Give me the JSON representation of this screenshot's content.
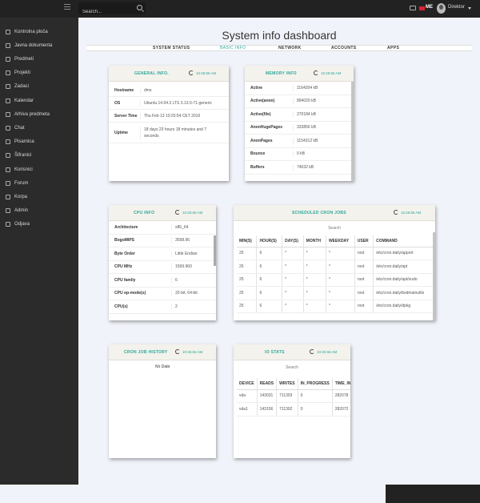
{
  "topbar": {
    "search_placeholder": "Search...",
    "lang": "ME",
    "user": "Direktor"
  },
  "sidebar": {
    "items": [
      {
        "label": "Kontrolna ploča",
        "icon": "dashboard-icon"
      },
      {
        "label": "Javna dokumenta",
        "icon": "folder-icon"
      },
      {
        "label": "Predmeti",
        "icon": "folder-icon"
      },
      {
        "label": "Projekti",
        "icon": "briefcase-icon"
      },
      {
        "label": "Zadaci",
        "icon": "tasks-icon"
      },
      {
        "label": "Kalendar",
        "icon": "calendar-icon"
      },
      {
        "label": "Arhiva predmeta",
        "icon": "archive-icon"
      },
      {
        "label": "Chat",
        "icon": "chat-icon"
      },
      {
        "label": "Pisarnica",
        "icon": "list-icon"
      },
      {
        "label": "Šifranici",
        "icon": "wrench-icon"
      },
      {
        "label": "Korisnici",
        "icon": "users-icon"
      },
      {
        "label": "Forum",
        "icon": "forum-icon"
      },
      {
        "label": "Korpa",
        "icon": "trash-icon"
      },
      {
        "label": "Admin",
        "icon": "admin-icon"
      },
      {
        "label": "Odjava",
        "icon": "logout-icon"
      }
    ]
  },
  "main": {
    "title": "System info dashboard",
    "tabs": [
      "SYSTEM STATUS",
      "BASIC INFO",
      "NETWORK",
      "ACCOUNTS",
      "APPS"
    ],
    "active_tab": "BASIC INFO"
  },
  "general": {
    "title": "GENERAL INFO.",
    "time": "10:25:56 AM",
    "rows": [
      {
        "k": "Hostname",
        "v": "dms"
      },
      {
        "k": "OS",
        "v": "Ubuntu 14.04.3 LTS 3.13.0-71-generic"
      },
      {
        "k": "Server Time",
        "v": "Thu Feb 13 10:25:54 CET 2016"
      },
      {
        "k": "Uptime",
        "v": "18 days 23 hours 18 minutes and 7 seconds"
      }
    ]
  },
  "memory": {
    "title": "MEMORY INFO",
    "time": "10:25:56 AM",
    "rows": [
      {
        "k": "Active",
        "v": "1164204 kB"
      },
      {
        "k": "Active(anon)",
        "v": "894020 kB"
      },
      {
        "k": "Active(file)",
        "v": "270184 kB"
      },
      {
        "k": "AnonHugePages",
        "v": "333856 kB"
      },
      {
        "k": "AnonPages",
        "v": "1154312 kB"
      },
      {
        "k": "Bounce",
        "v": "0 kB"
      },
      {
        "k": "Buffers",
        "v": "74032 kB"
      }
    ]
  },
  "cpu": {
    "title": "CPU INFO",
    "time": "10:25:56 AM",
    "rows": [
      {
        "k": "Architecture",
        "v": "x86_64"
      },
      {
        "k": "BogoMIPS",
        "v": "3598.96"
      },
      {
        "k": "Byte Order",
        "v": "Little Endian"
      },
      {
        "k": "CPU MHz",
        "v": "1599.960"
      },
      {
        "k": "CPU family",
        "v": "6"
      },
      {
        "k": "CPU op-mode(s)",
        "v": "32-bit, 64-bit"
      },
      {
        "k": "CPU(s)",
        "v": "2"
      }
    ]
  },
  "cron": {
    "title": "SCHEDULED CRON JOBS",
    "time": "10:25:56 AM",
    "search": "Search",
    "headers": [
      "MIN(S)",
      "HOUR(S)",
      "DAY(S)",
      "MONTH",
      "WEEKDAY",
      "USER",
      "COMMAND"
    ],
    "rows": [
      [
        "25",
        "6",
        "*",
        "*",
        "*",
        "root",
        "/etc/cron.daily/apport"
      ],
      [
        "25",
        "6",
        "*",
        "*",
        "*",
        "root",
        "/etc/cron.daily/apt"
      ],
      [
        "25",
        "6",
        "*",
        "*",
        "*",
        "root",
        "/etc/cron.daily/apt/sudo"
      ],
      [
        "25",
        "6",
        "*",
        "*",
        "*",
        "root",
        "/etc/cron.daily/bsdmainutils"
      ],
      [
        "25",
        "6",
        "*",
        "*",
        "*",
        "root",
        "/etc/cron.daily/dpkg"
      ]
    ]
  },
  "cronhistory": {
    "title": "CRON JOB HISTORY",
    "time": "10:25:56 AM",
    "empty": "No Data"
  },
  "io": {
    "title": "IO STATS",
    "time": "10:25:56 AM",
    "search": "Search",
    "headers": [
      "DEVICE",
      "READS",
      "WRITES",
      "IN_PROGRESS",
      "TIME_IN_IO"
    ],
    "rows": [
      [
        "vda",
        "143031",
        "711393",
        "0",
        "282078"
      ],
      [
        "vda1",
        "143156",
        "711392",
        "0",
        "282072"
      ]
    ]
  }
}
